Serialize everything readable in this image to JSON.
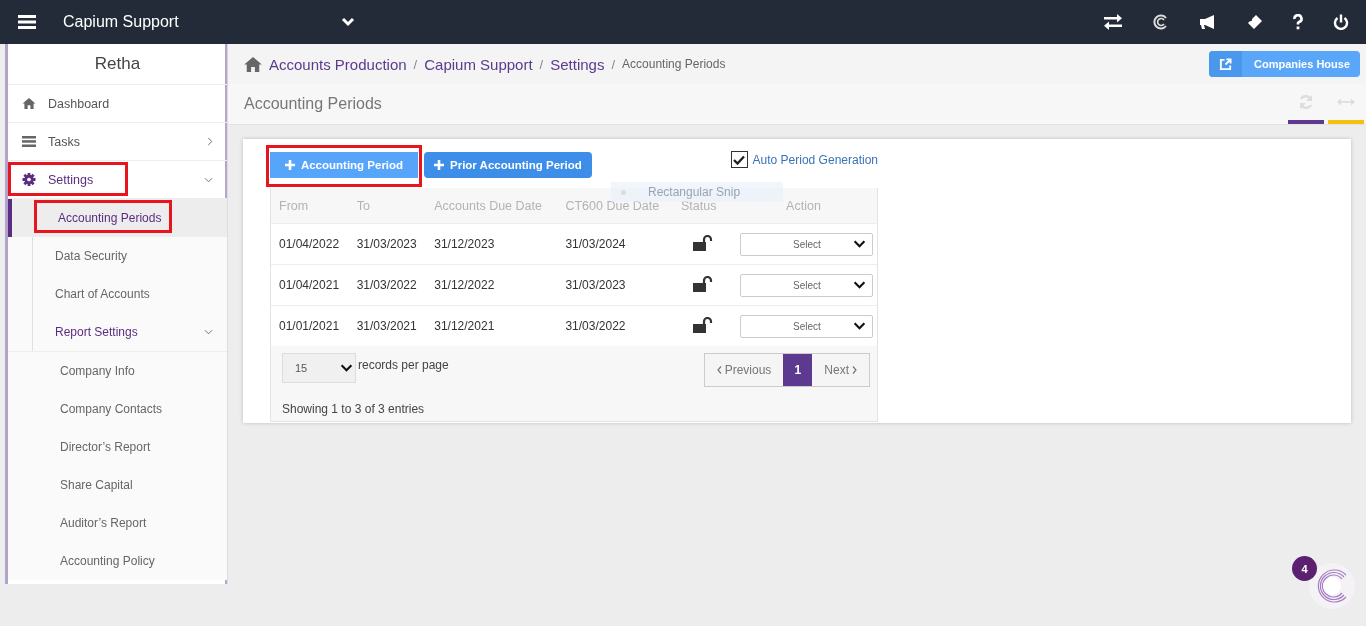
{
  "topbar": {
    "account": "Capium Support"
  },
  "sidebar": {
    "user": "Retha",
    "items": [
      {
        "label": "Dashboard",
        "kind": "home",
        "selected": false,
        "highlighted": false
      },
      {
        "label": "Tasks",
        "kind": "tasks",
        "selected": false,
        "highlighted": false,
        "expanded": false
      },
      {
        "label": "Settings",
        "kind": "settings",
        "selected": false,
        "highlighted": true,
        "expanded": true,
        "children": [
          {
            "label": "Accounting Periods",
            "selected": true,
            "highlighted": true
          },
          {
            "label": "Data Security",
            "selected": false,
            "highlighted": false
          },
          {
            "label": "Chart of Accounts",
            "selected": false,
            "highlighted": false
          },
          {
            "label": "Report Settings",
            "selected": false,
            "highlighted": false,
            "expanded": true,
            "children": [
              {
                "label": "Company Info",
                "selected": false
              },
              {
                "label": "Company Contacts",
                "selected": false
              },
              {
                "label": "Director’s Report",
                "selected": false
              },
              {
                "label": "Share Capital",
                "selected": false
              },
              {
                "label": "Auditor’s Report",
                "selected": false
              },
              {
                "label": "Accounting Policy",
                "selected": false
              }
            ]
          }
        ]
      }
    ]
  },
  "breadcrumb": [
    {
      "label": "Accounts Production",
      "kind": "link"
    },
    {
      "separator": "/",
      "label": "Capium Support",
      "kind": "link"
    },
    {
      "separator": "/",
      "label": "Settings",
      "kind": "link"
    },
    {
      "separator": "/",
      "label": "Accounting Periods",
      "kind": "current"
    }
  ],
  "companies_house_button": "Companies House",
  "page_title": "Accounting Periods",
  "buttons": [
    {
      "label": "Accounting Period",
      "highlighted": true
    },
    {
      "label": "Prior Accounting Period",
      "highlighted": false
    }
  ],
  "auto_period": {
    "label": "Auto Period Generation",
    "checked": true
  },
  "snip_overlay": "Rectangular Snip",
  "table": {
    "columns": [
      "From",
      "To",
      "Accounts Due Date",
      "CT600 Due Date",
      "Status",
      "Action"
    ],
    "rows": [
      {
        "cells": [
          "01/04/2022",
          "31/03/2023",
          "31/12/2023",
          "31/03/2024"
        ],
        "locked": false,
        "action": "Select"
      },
      {
        "cells": [
          "01/04/2021",
          "31/03/2022",
          "31/12/2022",
          "31/03/2023"
        ],
        "locked": false,
        "action": "Select"
      },
      {
        "cells": [
          "01/01/2021",
          "31/03/2021",
          "31/12/2021",
          "31/03/2022"
        ],
        "locked": false,
        "action": "Select"
      }
    ]
  },
  "pagination": {
    "page_size": "15",
    "page_size_label": "records per page",
    "previous": "Previous",
    "pages": [
      {
        "label": "1",
        "selected": true
      }
    ],
    "next": "Next",
    "summary": "Showing 1 to 3 of 3 entries"
  },
  "chat": {
    "count": "4"
  }
}
